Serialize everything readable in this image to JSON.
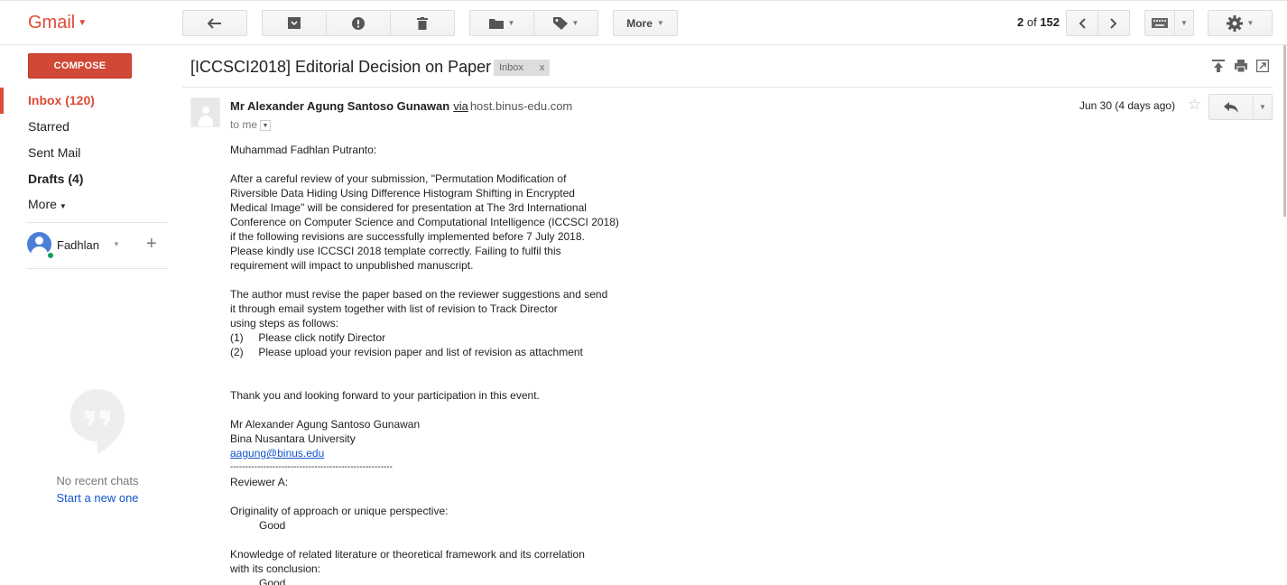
{
  "app": {
    "name": "Gmail"
  },
  "toolbar": {
    "more_label": "More",
    "pager_current": "2",
    "pager_of": "of",
    "pager_total": "152"
  },
  "nav": {
    "compose_label": "COMPOSE",
    "items": [
      {
        "label": "Inbox (120)"
      },
      {
        "label": "Starred"
      },
      {
        "label": "Sent Mail"
      },
      {
        "label": "Drafts (4)"
      },
      {
        "label": "More"
      }
    ]
  },
  "chat": {
    "user_name": "Fadhlan",
    "empty_text": "No recent chats",
    "start_text": "Start a new one"
  },
  "email": {
    "subject": "[ICCSCI2018] Editorial Decision on Paper",
    "label": "Inbox",
    "label_remove": "x",
    "sender": "Mr Alexander Agung Santoso Gunawan",
    "via": "via",
    "via_host": "host.binus-edu.com",
    "to": "to me",
    "date": "Jun 30 (4 days ago)",
    "greeting": "Muhammad Fadhlan Putranto:",
    "para1": "After a careful review of your submission, \"Permutation Modification of\nRiversible Data Hiding Using Difference Histogram Shifting in Encrypted\nMedical Image\" will be considered for presentation at The 3rd International\nConference on Computer Science and Computational Intelligence (ICCSCI 2018)\nif the following revisions are successfully implemented before 7 July 2018.\nPlease kindly use ICCSCI 2018 template correctly. Failing to fulfil this\nrequirement will impact to unpublished manuscript.",
    "para2": "The author must revise the paper based on the reviewer suggestions and send\nit through email system together with list of revision to Track Director\nusing steps as follows:",
    "step1": "(1)     Please click notify Director",
    "step2": "(2)     Please upload your revision paper and list of revision as attachment",
    "thanks": "Thank you and looking forward to your participation in this event.",
    "sig_name": "Mr Alexander Agung Santoso Gunawan",
    "sig_org": "Bina Nusantara University",
    "sig_email": "aagung@binus.edu",
    "rule": "------------------------------------------------------",
    "reviewer": "Reviewer A:",
    "q1": "Originality of approach or unique perspective:",
    "a1": "Good",
    "q2": "Knowledge of related literature or theoretical framework and its correlation\nwith its conclusion:",
    "a2": "Good"
  },
  "icons": [
    "back-icon",
    "archive-icon",
    "report-spam-icon",
    "delete-icon",
    "folder-icon",
    "label-icon",
    "chevron-left-icon",
    "chevron-right-icon",
    "keyboard-icon",
    "gear-icon",
    "reply-icon",
    "star-icon",
    "print-icon",
    "new-window-icon",
    "expand-icon"
  ]
}
